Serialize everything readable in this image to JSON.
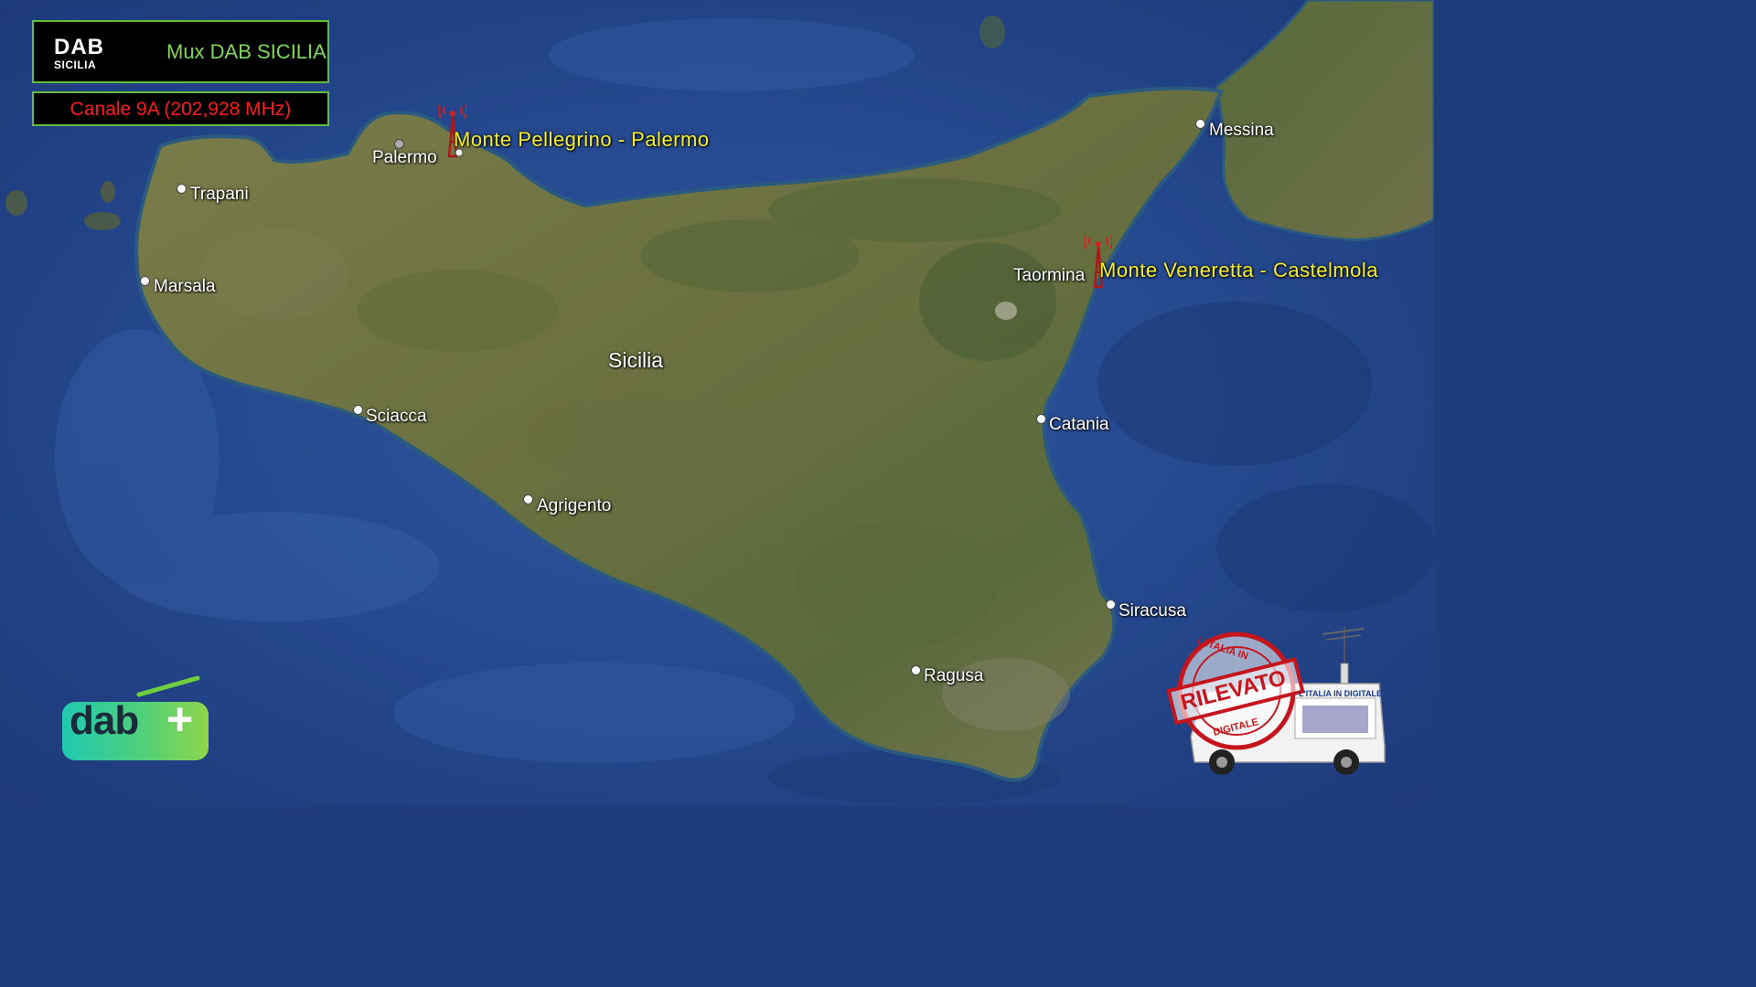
{
  "header": {
    "logo_line1": "DAB",
    "logo_line2": "SICILIA",
    "mux_label": "Mux DAB SICILIA",
    "channel_label": "Canale 9A (202,928 MHz)"
  },
  "map": {
    "region_label": "Sicilia",
    "cities": [
      {
        "name": "Palermo"
      },
      {
        "name": "Trapani"
      },
      {
        "name": "Marsala"
      },
      {
        "name": "Sciacca"
      },
      {
        "name": "Agrigento"
      },
      {
        "name": "Ragusa"
      },
      {
        "name": "Siracusa"
      },
      {
        "name": "Catania"
      },
      {
        "name": "Taormina"
      },
      {
        "name": "Messina"
      }
    ],
    "transmitters": [
      {
        "name": "Monte Pellegrino - Palermo"
      },
      {
        "name": "Monte Veneretta - Castelmola"
      }
    ]
  },
  "branding": {
    "dabplus_text": "dab",
    "dabplus_plus": "+",
    "stamp_top": "L'ITALIA IN",
    "stamp_middle": "RILEVATO",
    "stamp_bottom": "DIGITALE",
    "van_sign": "L'ITALIA IN DIGITALE"
  },
  "colors": {
    "sea": "#27498f",
    "land": "#6e7442",
    "frame_border": "#5fbf3a",
    "mux_text": "#7ed957",
    "channel_text": "#ff1a1a",
    "transmitter_text": "#f7ef2e",
    "stamp_red": "#c5161d"
  },
  "icons": {
    "transmitter": "radio-tower-icon",
    "city": "city-dot-icon",
    "logo": "dab-plus-logo-icon",
    "stamp": "rilevato-stamp-icon",
    "van": "broadcast-van-icon"
  }
}
